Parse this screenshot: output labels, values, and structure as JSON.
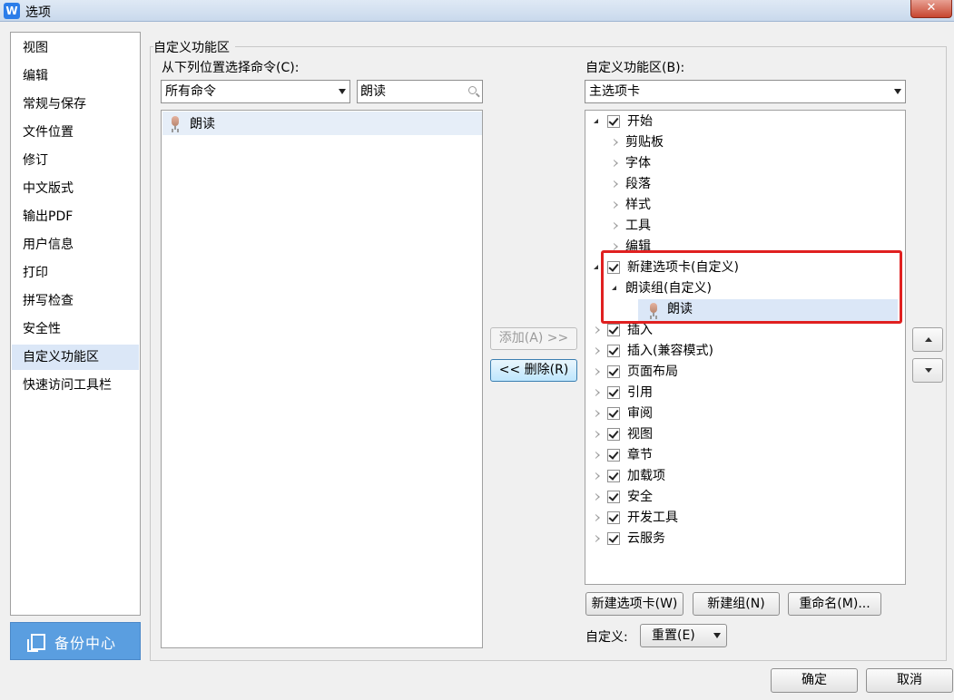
{
  "window": {
    "app_icon": "W",
    "title": "选项",
    "close_glyph": "✕"
  },
  "nav": {
    "items": [
      "视图",
      "编辑",
      "常规与保存",
      "文件位置",
      "修订",
      "中文版式",
      "输出PDF",
      "用户信息",
      "打印",
      "拼写检查",
      "安全性",
      "自定义功能区",
      "快速访问工具栏"
    ],
    "selected": "自定义功能区",
    "backup_label": "备份中心"
  },
  "section_title": "自定义功能区",
  "left": {
    "label": "从下列位置选择命令(C):",
    "source_value": "所有命令",
    "search_value": "朗读",
    "commands": [
      {
        "label": "朗读",
        "icon": "microphone-icon"
      }
    ]
  },
  "buttons": {
    "add": "添加(A) >>",
    "remove": "<< 删除(R)"
  },
  "right": {
    "label": "自定义功能区(B):",
    "tabs_value": "主选项卡",
    "tree": [
      {
        "label": "开始",
        "level": 0,
        "checked": true,
        "expanded": true
      },
      {
        "label": "剪贴板",
        "level": 1
      },
      {
        "label": "字体",
        "level": 1
      },
      {
        "label": "段落",
        "level": 1
      },
      {
        "label": "样式",
        "level": 1
      },
      {
        "label": "工具",
        "level": 1
      },
      {
        "label": "编辑",
        "level": 1
      },
      {
        "label": "新建选项卡(自定义)",
        "level": 0,
        "checked": true,
        "expanded": true
      },
      {
        "label": "朗读组(自定义)",
        "level": 1,
        "expanded": true
      },
      {
        "label": "朗读",
        "level": 2,
        "icon": "microphone-icon",
        "selected": true
      },
      {
        "label": "插入",
        "level": 0,
        "checked": true
      },
      {
        "label": "插入(兼容模式)",
        "level": 0,
        "checked": true
      },
      {
        "label": "页面布局",
        "level": 0,
        "checked": true
      },
      {
        "label": "引用",
        "level": 0,
        "checked": true
      },
      {
        "label": "审阅",
        "level": 0,
        "checked": true
      },
      {
        "label": "视图",
        "level": 0,
        "checked": true
      },
      {
        "label": "章节",
        "level": 0,
        "checked": true
      },
      {
        "label": "加载项",
        "level": 0,
        "checked": true
      },
      {
        "label": "安全",
        "level": 0,
        "checked": true
      },
      {
        "label": "开发工具",
        "level": 0,
        "checked": true
      },
      {
        "label": "云服务",
        "level": 0,
        "checked": true
      }
    ],
    "new_tab": "新建选项卡(W)",
    "new_group": "新建组(N)",
    "rename": "重命名(M)...",
    "customize_label": "自定义:",
    "reset": "重置(E)"
  },
  "footer": {
    "ok": "确定",
    "cancel": "取消"
  },
  "colors": {
    "selection": "#dbe7f7",
    "highlight_border": "#e02020",
    "backup_bg": "#5a9ee0"
  }
}
